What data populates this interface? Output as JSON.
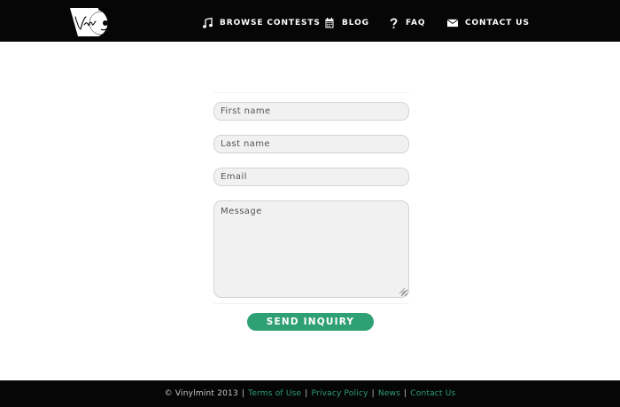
{
  "header": {
    "logo_name": "vinylmint-logo",
    "nav": [
      {
        "label": "BROWSE CONTESTS",
        "icon": "music-note-icon"
      },
      {
        "label": "BLOG",
        "icon": "calendar-icon"
      },
      {
        "label": "FAQ",
        "icon": "question-mark-icon"
      },
      {
        "label": "CONTACT US",
        "icon": "envelope-icon"
      }
    ]
  },
  "form": {
    "first_name_placeholder": "First name",
    "last_name_placeholder": "Last name",
    "email_placeholder": "Email",
    "message_placeholder": "Message",
    "submit_label": "SEND INQUIRY"
  },
  "footer": {
    "copyright": "© Vinylmint 2013",
    "links": [
      "Terms of Use",
      "Privacy Policy",
      "News",
      "Contact Us"
    ]
  },
  "colors": {
    "header_bg": "#060607",
    "accent": "#2f9f74",
    "field_bg": "#f1f1f1",
    "field_border": "#d4d4d4"
  }
}
